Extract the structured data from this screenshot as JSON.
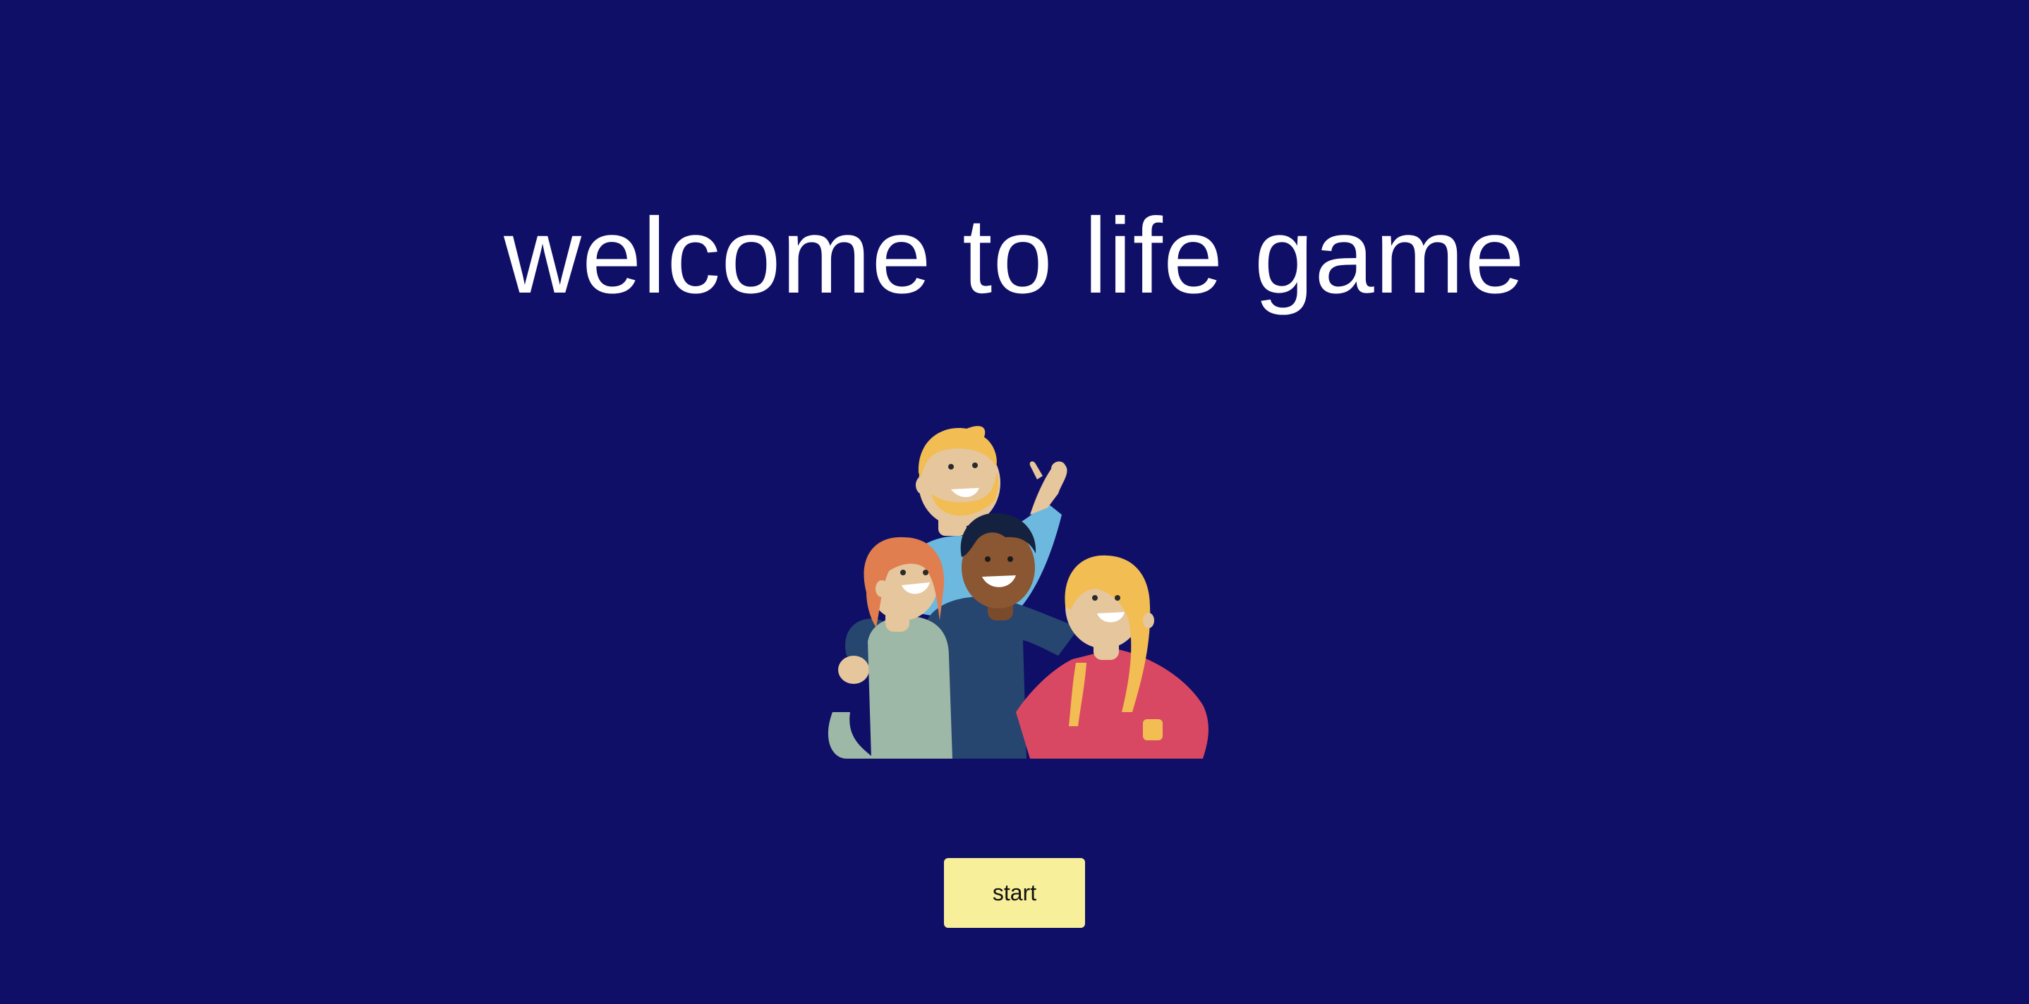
{
  "title": "welcome to life game",
  "illustration": {
    "icon": "group-of-friends-illustration"
  },
  "start_button": {
    "label": "start"
  },
  "colors": {
    "background": "#0f0f68",
    "title_text": "#ffffff",
    "button_background": "#f7ef9a",
    "button_text": "#111111"
  }
}
